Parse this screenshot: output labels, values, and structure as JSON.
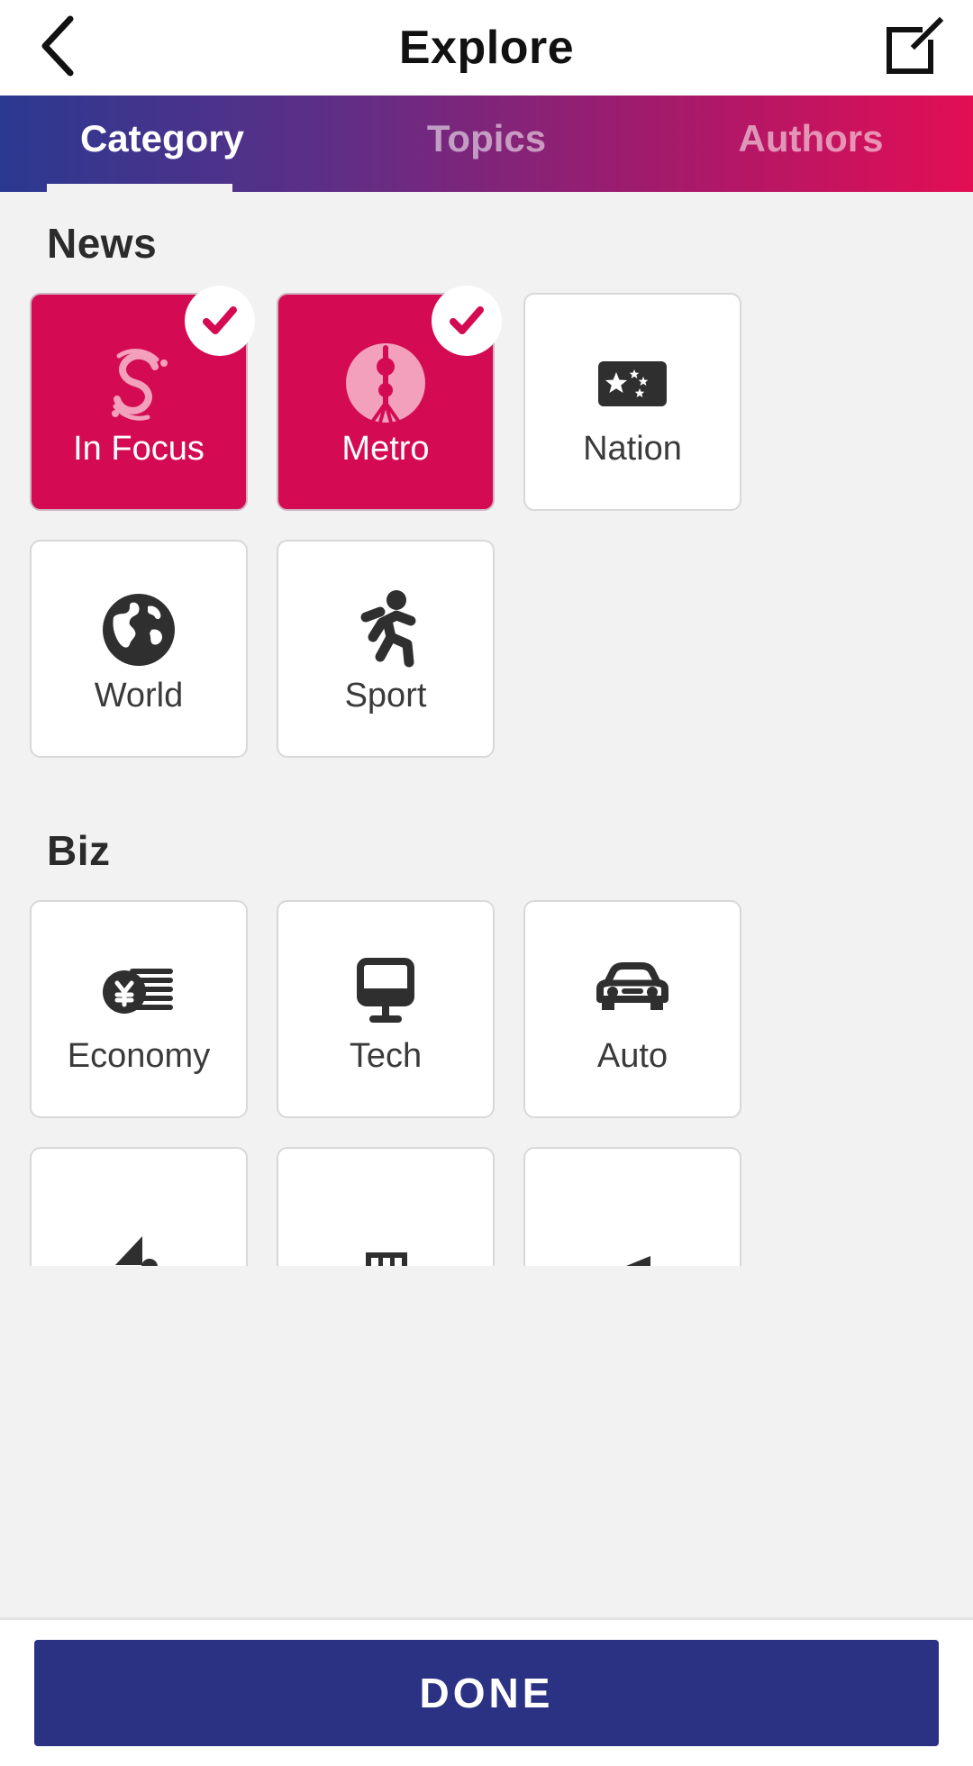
{
  "header": {
    "back_icon": "chevron-left-icon",
    "title": "Explore",
    "compose_icon": "compose-icon"
  },
  "tabs": [
    {
      "label": "Category",
      "active": true
    },
    {
      "label": "Topics",
      "active": false
    },
    {
      "label": "Authors",
      "active": false
    }
  ],
  "colors": {
    "gradient_start": "#2b3990",
    "gradient_end": "#e30e54",
    "selected_card": "#d40b52",
    "done_button": "#2b3283",
    "page_background": "#f2f2f2"
  },
  "sections": [
    {
      "title": "News",
      "cards": [
        {
          "label": "In Focus",
          "icon": "s-logo-icon",
          "selected": true
        },
        {
          "label": "Metro",
          "icon": "tower-icon",
          "selected": true
        },
        {
          "label": "Nation",
          "icon": "flag-icon",
          "selected": false
        },
        {
          "label": "World",
          "icon": "globe-icon",
          "selected": false
        },
        {
          "label": "Sport",
          "icon": "running-person-icon",
          "selected": false
        }
      ]
    },
    {
      "title": "Biz",
      "cards": [
        {
          "label": "Economy",
          "icon": "yen-coins-icon",
          "selected": false
        },
        {
          "label": "Tech",
          "icon": "monitor-icon",
          "selected": false
        },
        {
          "label": "Auto",
          "icon": "car-icon",
          "selected": false
        }
      ]
    }
  ],
  "partial_row": [
    {
      "icon": "boat-icon"
    },
    {
      "icon": "building-icon"
    },
    {
      "icon": "arrow-icon"
    }
  ],
  "footer": {
    "done_label": "DONE"
  }
}
